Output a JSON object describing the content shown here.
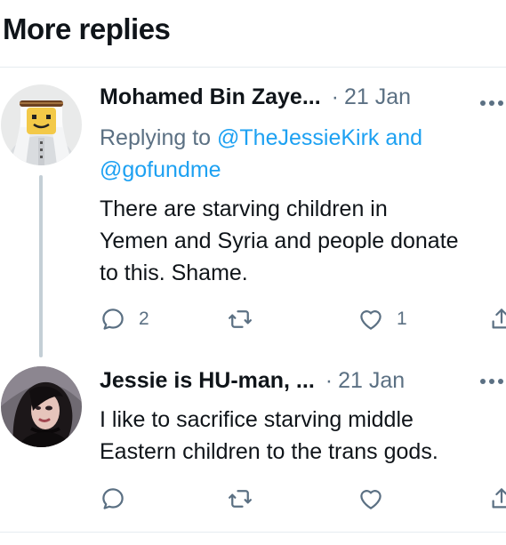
{
  "header": {
    "title": "More replies"
  },
  "tweets": [
    {
      "avatar_icon": "avatar-man-in-headdress",
      "name": "Mohamed Bin Zaye...",
      "separator": "·",
      "date": "21 Jan",
      "reply_prefix": "Replying to",
      "reply_line1_mention": "@TheJessieKirk",
      "reply_line1_and": "and",
      "reply_line2_mention": "@gofundme",
      "text": "There are starving children in\nYemen and Syria and people donate\nto this. Shame.",
      "reply_count": "2",
      "retweet_count": "",
      "like_count": "1"
    },
    {
      "avatar_icon": "avatar-person-dark-hair",
      "name": "Jessie is HU-man, ...",
      "separator": "·",
      "date": "21 Jan",
      "text": "I like to sacrifice starving middle\nEastern children to the trans gods.",
      "reply_count": "",
      "retweet_count": "",
      "like_count": ""
    }
  ],
  "colors": {
    "accent": "#1da1f2",
    "muted": "#5b7083",
    "text": "#0f1419",
    "divider": "#e6ecf0"
  }
}
